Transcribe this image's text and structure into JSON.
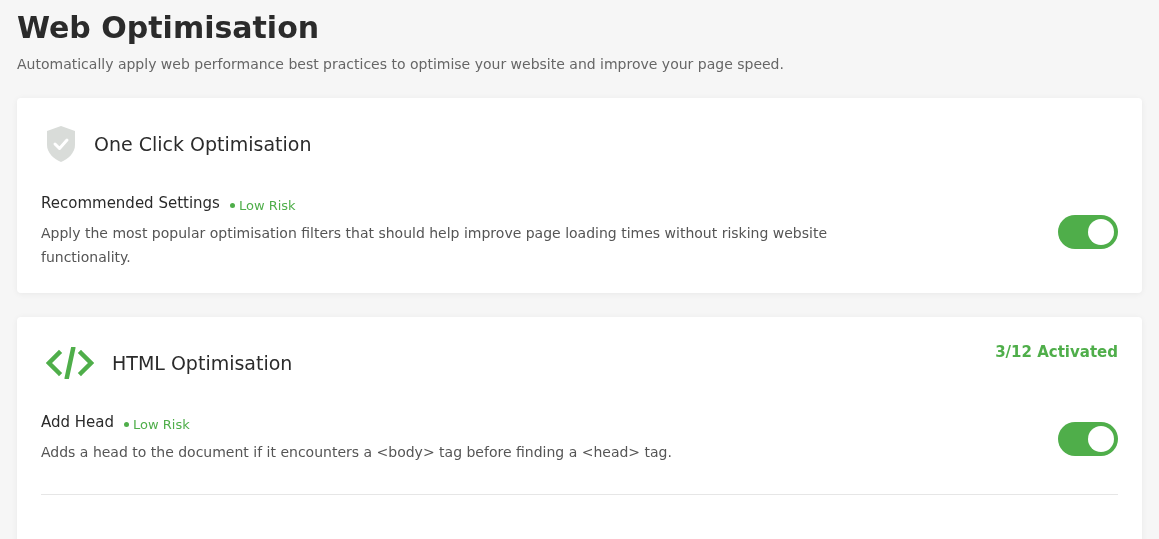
{
  "page": {
    "title": "Web Optimisation",
    "subtitle": "Automatically apply web performance best practices to optimise your website and improve your page speed."
  },
  "cards": [
    {
      "kind": "shield",
      "title": "One Click Optimisation",
      "settings": [
        {
          "name": "Recommended Settings",
          "risk": "Low Risk",
          "description": "Apply the most popular optimisation filters that should help improve page loading times without risking website functionality.",
          "on": true
        }
      ]
    },
    {
      "kind": "code",
      "title": "HTML Optimisation",
      "activated": "3/12 Activated",
      "settings": [
        {
          "name": "Add Head",
          "risk": "Low Risk",
          "description": "Adds a head to the document if it encounters a <body> tag before finding a <head> tag.",
          "on": true
        }
      ]
    }
  ]
}
